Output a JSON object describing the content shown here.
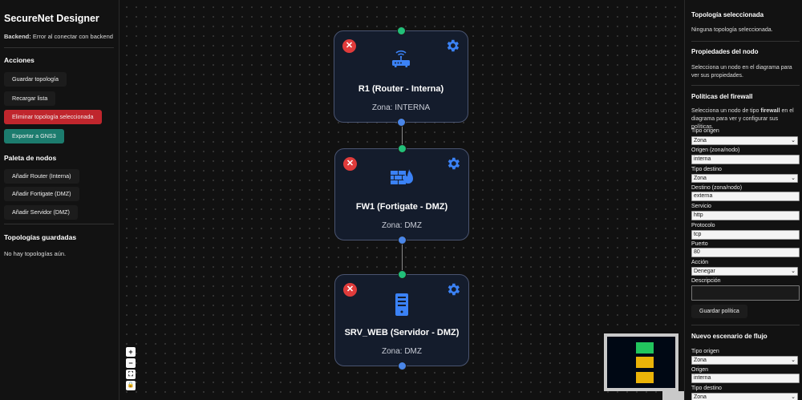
{
  "left": {
    "app_title": "SecureNet Designer",
    "backend_label": "Backend:",
    "backend_status": "Error al conectar con backend",
    "actions_title": "Acciones",
    "actions": {
      "save": "Guardar topología",
      "reload": "Recargar lista",
      "delete": "Eliminar topología seleccionada",
      "export": "Exportar a GNS3"
    },
    "palette_title": "Paleta de nodos",
    "palette": {
      "router": "Añadir Router (Interna)",
      "fortigate": "Añadir Fortigate (DMZ)",
      "server": "Añadir Servidor (DMZ)"
    },
    "saved_title": "Topologías guardadas",
    "saved_empty": "No hay topologías aún."
  },
  "nodes": [
    {
      "label": "R1 (Router - Interna)",
      "zone": "Zona: INTERNA",
      "icon": "router-icon"
    },
    {
      "label": "FW1 (Fortigate - DMZ)",
      "zone": "Zona: DMZ",
      "icon": "firewall-icon"
    },
    {
      "label": "SRV_WEB (Servidor - DMZ)",
      "zone": "Zona: DMZ",
      "icon": "server-icon"
    }
  ],
  "zoom_controls": {
    "zoom_in": "+",
    "zoom_out": "−",
    "fit": "⛶",
    "lock": "🔒"
  },
  "minimap": {
    "colors": [
      "#22c55e",
      "#eab308",
      "#eab308"
    ]
  },
  "right": {
    "selected_topology_title": "Topología seleccionada",
    "selected_topology_text": "Ninguna topología seleccionada.",
    "node_props_title": "Propiedades del nodo",
    "node_props_text": "Selecciona un nodo en el diagrama para ver sus propiedades.",
    "firewall_title": "Políticas del firewall",
    "firewall_text_pre": "Selecciona un nodo de tipo ",
    "firewall_text_bold": "firewall",
    "firewall_text_post": " en el diagrama para ver y configurar sus políticas.",
    "policy": {
      "tipo_origen_label": "Tipo origen",
      "tipo_origen_value": "Zona",
      "origen_label": "Origen (zona/nodo)",
      "origen_value": "interna",
      "tipo_destino_label": "Tipo destino",
      "tipo_destino_value": "Zona",
      "destino_label": "Destino (zona/nodo)",
      "destino_value": "externa",
      "servicio_label": "Servicio",
      "servicio_value": "http",
      "protocolo_label": "Protocolo",
      "protocolo_value": "tcp",
      "puerto_label": "Puerto",
      "puerto_value": "80",
      "accion_label": "Acción",
      "accion_value": "Denegar",
      "descripcion_label": "Descripción",
      "save_button": "Guardar política"
    },
    "flow_title": "Nuevo escenario de flujo",
    "flow": {
      "tipo_origen_label": "Tipo origen",
      "tipo_origen_value": "Zona",
      "origen_label": "Origen",
      "origen_value": "interna",
      "tipo_destino_label": "Tipo destino",
      "tipo_destino_value": "Zona"
    }
  }
}
